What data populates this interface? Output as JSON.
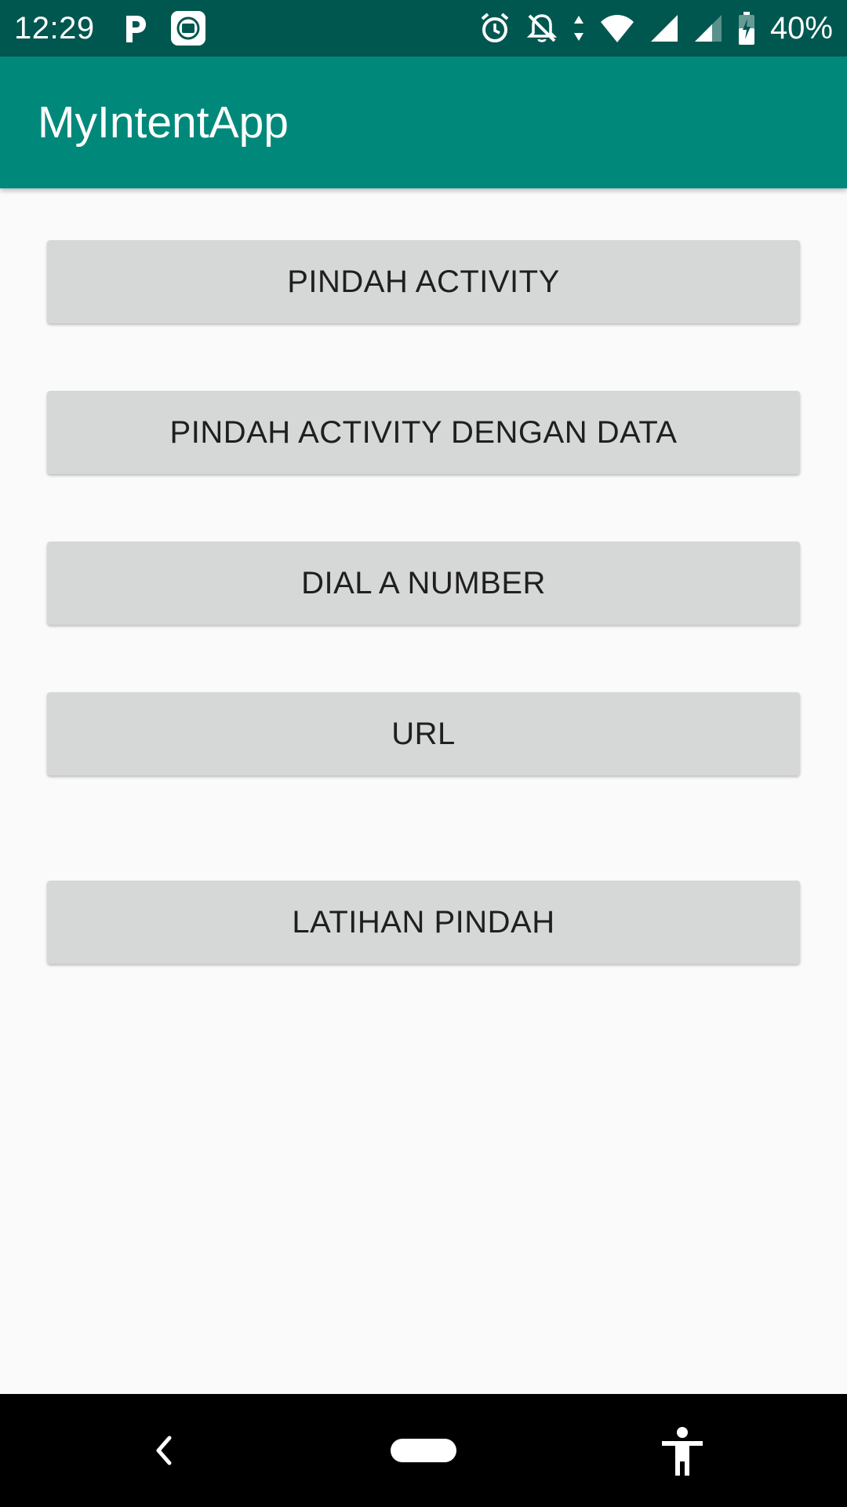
{
  "status_bar": {
    "time": "12:29",
    "battery": "40%",
    "left_icons": [
      "p-app-icon",
      "mi-app-icon"
    ],
    "right_icons": [
      "alarm-icon",
      "notifications-off-icon",
      "data-arrows-icon",
      "wifi-icon",
      "signal-icon",
      "signal-2-icon",
      "battery-charging-icon"
    ]
  },
  "app_bar": {
    "title": "MyIntentApp",
    "color": "#00897b"
  },
  "buttons": [
    {
      "label": "PINDAH ACTIVITY"
    },
    {
      "label": "PINDAH ACTIVITY DENGAN DATA"
    },
    {
      "label": "DIAL A NUMBER"
    },
    {
      "label": "URL"
    },
    {
      "label": "LATIHAN PINDAH"
    }
  ],
  "nav_bar": {
    "icons": [
      "back-icon",
      "home-pill-icon",
      "accessibility-icon"
    ]
  },
  "colors": {
    "status_bar": "#00574f",
    "primary": "#00897b",
    "button_bg": "#d6d7d7",
    "background": "#fafafa"
  }
}
